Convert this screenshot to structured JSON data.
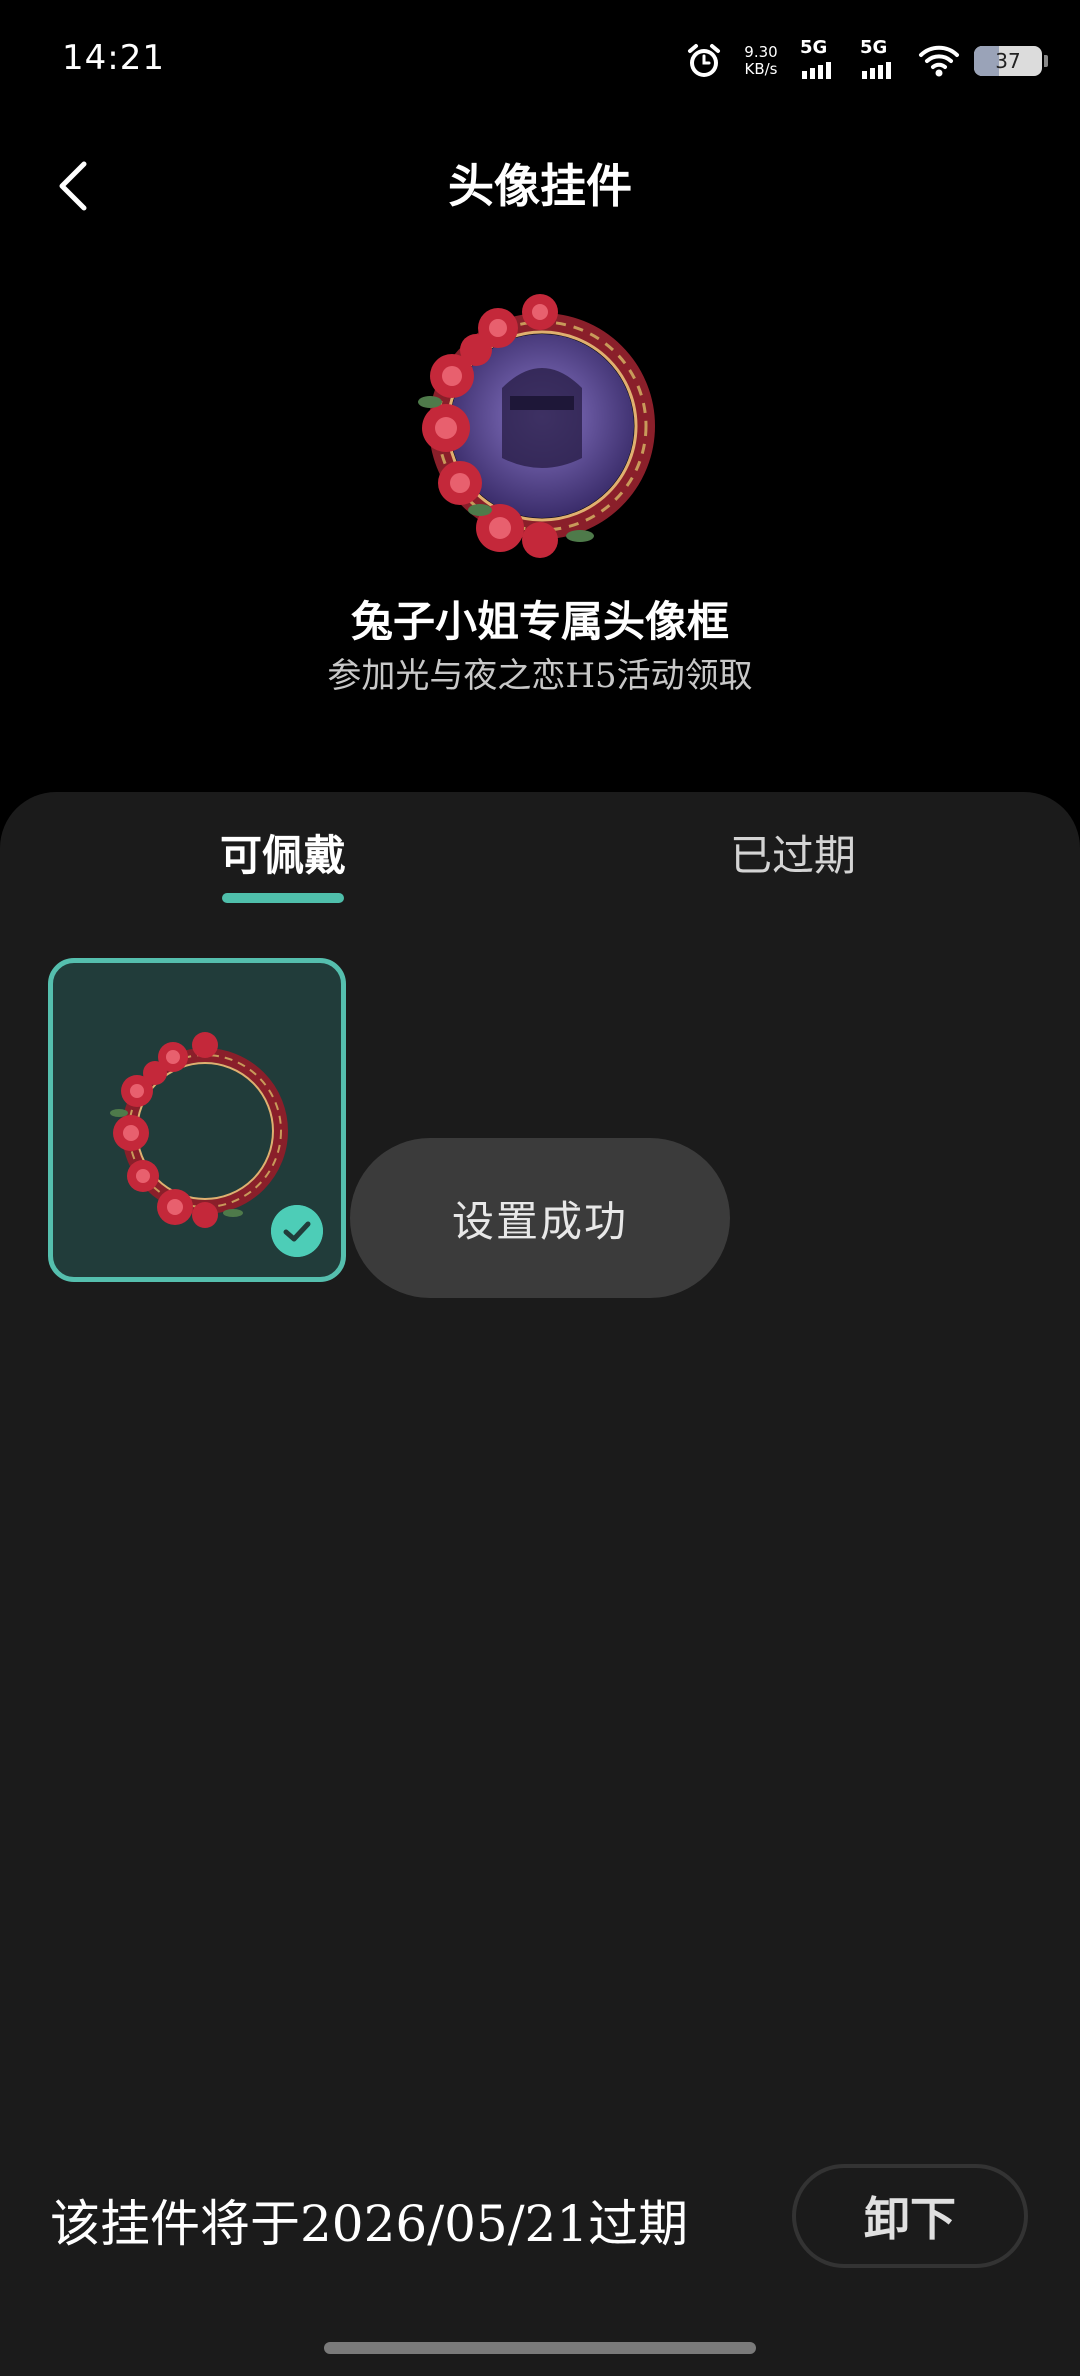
{
  "status_bar": {
    "time": "14:21",
    "speed_value": "9.30",
    "speed_unit": "KB/s",
    "sim1_label": "5G",
    "sim2_label": "5G",
    "battery": "37",
    "battery_level": 0.37
  },
  "header": {
    "title": "头像挂件"
  },
  "preview": {
    "name": "兔子小姐专属头像框",
    "description": "参加光与夜之恋H5活动领取"
  },
  "tabs": [
    {
      "label": "可佩戴",
      "active": true
    },
    {
      "label": "已过期",
      "active": false
    }
  ],
  "items": [
    {
      "selected": true
    }
  ],
  "toast": "设置成功",
  "footer": {
    "expiry_text": "该挂件将于2026/05/21过期",
    "unload_label": "卸下"
  },
  "colors": {
    "accent": "#4fbfab",
    "sheet_bg": "#1b1b1b",
    "card_bg": "#213c3a",
    "toast_bg": "#3b3b3b"
  }
}
